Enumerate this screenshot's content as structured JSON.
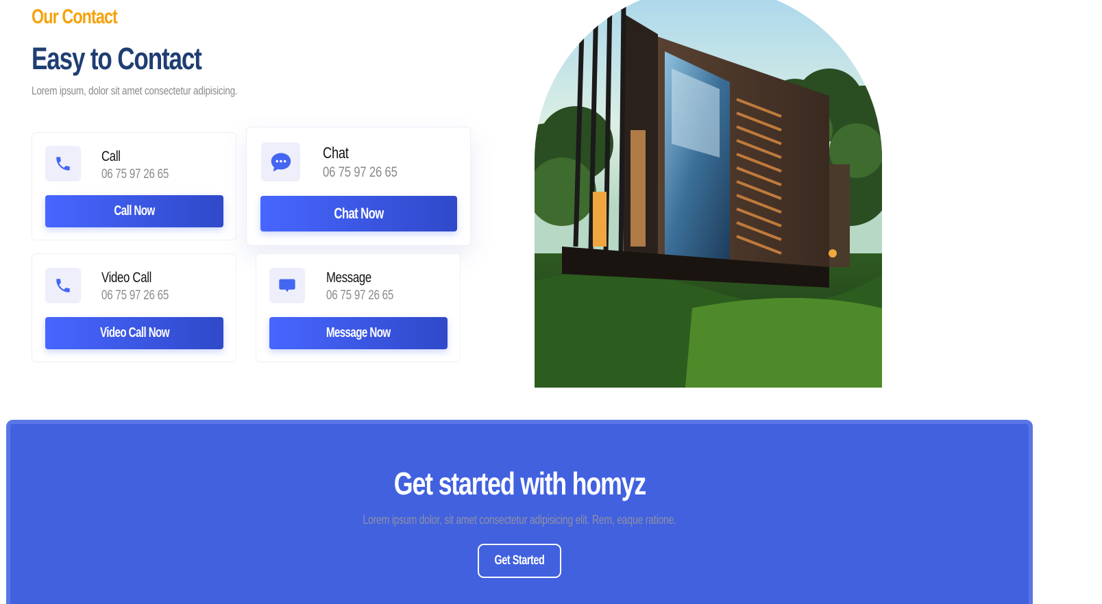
{
  "section": {
    "eyebrow": "Our Contact",
    "title": "Easy to Contact",
    "description": "Lorem ipsum, dolor sit amet consectetur adipisicing."
  },
  "contact_modes": [
    {
      "icon": "phone-icon",
      "title": "Call",
      "detail": "06 75 97 26 65",
      "button": "Call Now"
    },
    {
      "icon": "chat-bubble-icon",
      "title": "Chat",
      "detail": "06 75 97 26 65",
      "button": "Chat Now"
    },
    {
      "icon": "phone-icon",
      "title": "Video Call",
      "detail": "06 75 97 26 65",
      "button": "Video Call Now"
    },
    {
      "icon": "message-icon",
      "title": "Message",
      "detail": "06 75 97 26 65",
      "button": "Message Now"
    }
  ],
  "get_started": {
    "title": "Get started with homyz",
    "description": "Lorem ipsum dolor, sit amet consectetur adipisicing elit. Rem, eaque ratione.",
    "button": "Get Started"
  },
  "colors": {
    "accent_orange": "#f5a20a",
    "heading_navy": "#1f3e72",
    "button_blue": "#4766ff",
    "banner_blue": "#4161df"
  }
}
